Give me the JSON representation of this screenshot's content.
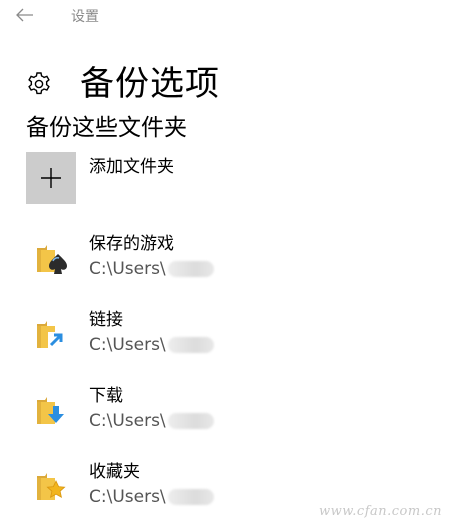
{
  "titlebar": {
    "app_title": "设置"
  },
  "header": {
    "title": "备份选项"
  },
  "section": {
    "title": "备份这些文件夹",
    "add_folder_label": "添加文件夹"
  },
  "folders": [
    {
      "name": "保存的游戏",
      "path": "C:\\Users\\",
      "icon": "saved-games-folder-icon"
    },
    {
      "name": "链接",
      "path": "C:\\Users\\",
      "icon": "links-folder-icon"
    },
    {
      "name": "下载",
      "path": "C:\\Users\\",
      "icon": "downloads-folder-icon"
    },
    {
      "name": "收藏夹",
      "path": "C:\\Users\\",
      "icon": "favorites-folder-icon"
    }
  ],
  "watermark": "www.cfan.com.cn",
  "colors": {
    "add_tile": "#cccccc",
    "folder_yellow": "#f3c548",
    "arrow_blue": "#2b8ee0",
    "star_gold": "#f2b51d"
  }
}
